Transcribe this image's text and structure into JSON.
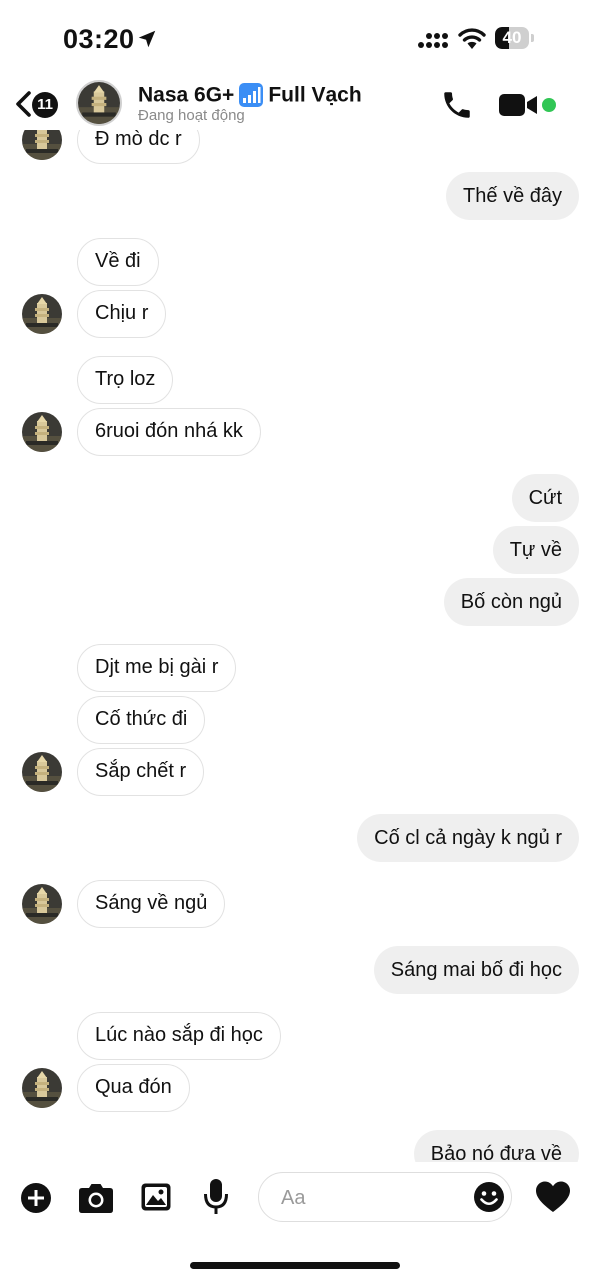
{
  "status_bar": {
    "time": "03:20",
    "battery_level": "40",
    "battery_fraction": 0.4
  },
  "header": {
    "back_count": "11",
    "name_prefix": "Nasa 6G+",
    "name_icon": "signal-bars-emoji",
    "name_suffix": "Full Vạch",
    "status": "Đang hoạt động",
    "online_color": "#31c655"
  },
  "messages": [
    {
      "dir": "in",
      "text": "Đ mò dc r"
    },
    {
      "dir": "out",
      "text": "Thế về đây"
    },
    {
      "dir": "in",
      "text": "Về đi"
    },
    {
      "dir": "in",
      "text": "Chịu r"
    },
    {
      "dir": "in",
      "text": "Trọ loz"
    },
    {
      "dir": "in",
      "text": "6ruoi đón nhá kk"
    },
    {
      "dir": "out",
      "text": "Cứt"
    },
    {
      "dir": "out",
      "text": "Tự về"
    },
    {
      "dir": "out",
      "text": "Bố còn ngủ"
    },
    {
      "dir": "in",
      "text": "Djt me bị gài r"
    },
    {
      "dir": "in",
      "text": "Cố thức đi"
    },
    {
      "dir": "in",
      "text": "Sắp chết r"
    },
    {
      "dir": "out",
      "text": "Cố cl cả ngày k ngủ r"
    },
    {
      "dir": "in",
      "text": "Sáng về ngủ"
    },
    {
      "dir": "out",
      "text": "Sáng mai bố đi học"
    },
    {
      "dir": "in",
      "text": "Lúc nào sắp đi học"
    },
    {
      "dir": "in",
      "text": "Qua đón"
    },
    {
      "dir": "out",
      "text": "Bảo nó đưa về"
    }
  ],
  "composer": {
    "placeholder": "Aa",
    "value": "",
    "icons": [
      "plus-icon",
      "camera-icon",
      "image-icon",
      "microphone-icon",
      "emoji-icon",
      "heart-icon"
    ]
  }
}
